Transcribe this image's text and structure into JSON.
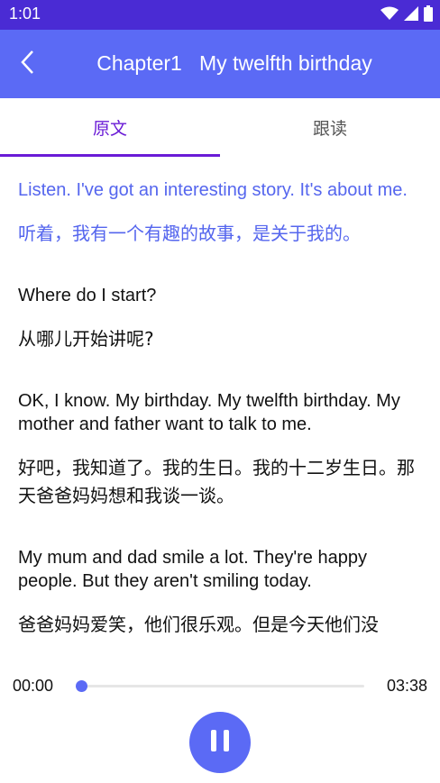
{
  "status_bar": {
    "time": "1:01"
  },
  "app_bar": {
    "title": "Chapter1   My twelfth birthday"
  },
  "tabs": [
    {
      "label": "原文",
      "selected": true
    },
    {
      "label": "跟读",
      "selected": false
    }
  ],
  "paragraphs": [
    {
      "en": "Listen. I've got an interesting story. It's about me.",
      "zh": "听着，我有一个有趣的故事，是关于我的。",
      "active": true
    },
    {
      "en": "Where do I start?",
      "zh": "从哪儿开始讲呢?",
      "active": false
    },
    {
      "en": "OK, I know. My birthday. My twelfth birthday. My mother and father want to talk to me.",
      "zh": "好吧，我知道了。我的生日。我的十二岁生日。那天爸爸妈妈想和我谈一谈。",
      "active": false
    },
    {
      "en": "My mum and dad smile a lot. They're happy people. But they aren't smiling today.",
      "zh": "爸爸妈妈爱笑，他们很乐观。但是今天他们没",
      "active": false
    }
  ],
  "player": {
    "current_time": "00:00",
    "total_time": "03:38",
    "progress": 0.0,
    "state": "playing"
  },
  "colors": {
    "status_bar": "#4a2bd4",
    "app_bar": "#5b6af5",
    "tab_active": "#6a1bd6",
    "highlight_text": "#5566ee"
  }
}
